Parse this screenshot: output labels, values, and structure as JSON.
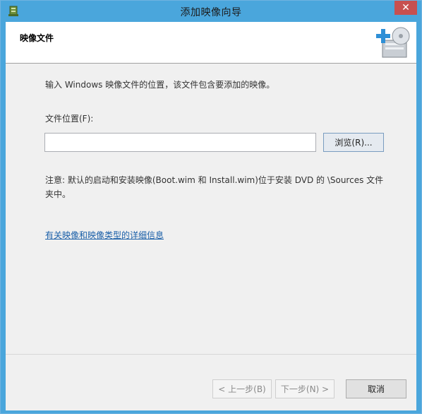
{
  "window": {
    "title": "添加映像向导",
    "close_glyph": "✕"
  },
  "header": {
    "title": "映像文件"
  },
  "main": {
    "intro_text": "输入 Windows 映像文件的位置，该文件包含要添加的映像。",
    "location_label": "文件位置(F):",
    "location_value": "",
    "browse_label": "浏览(R)...",
    "note_text": "注意: 默认的启动和安装映像(Boot.wim 和 Install.wim)位于安装 DVD 的 \\Sources 文件夹中。",
    "details_link": "有关映像和映像类型的详细信息"
  },
  "footer": {
    "back_label": "< 上一步(B)",
    "next_label": "下一步(N) >",
    "cancel_label": "取消"
  },
  "colors": {
    "title_bar": "#4aa6dc",
    "close_button": "#c75050",
    "link": "#1a5fa8"
  }
}
